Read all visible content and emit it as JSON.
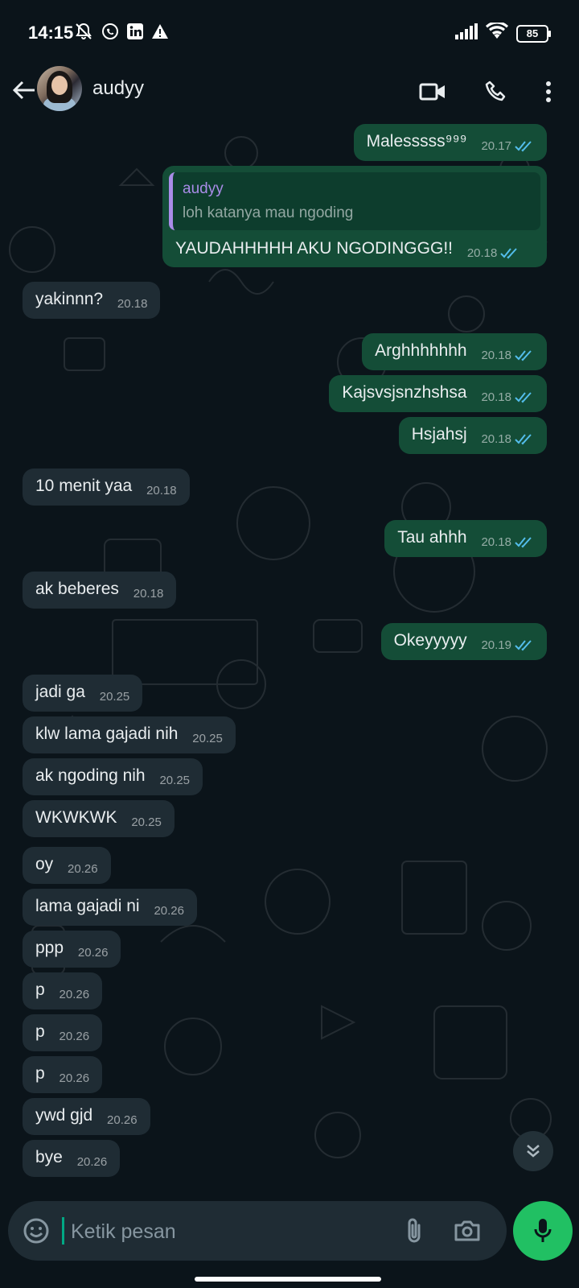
{
  "statusbar": {
    "time": "14:15",
    "battery": "85",
    "left_icons": [
      "mute-bell-icon",
      "whatsapp-icon",
      "linkedin-icon",
      "warning-icon"
    ],
    "right_icons": [
      "signal-icon",
      "wifi-icon",
      "battery-icon"
    ]
  },
  "header": {
    "contact_name": "audyy",
    "icons": [
      "back-arrow-icon",
      "video-call-icon",
      "voice-call-icon",
      "more-vert-icon"
    ]
  },
  "messages": [
    {
      "dir": "out",
      "text": "Malesssss⁹⁹⁹",
      "time": "20.17",
      "status": "read"
    },
    {
      "dir": "out",
      "text": "YAUDAHHHHH AKU NGODINGGG!!",
      "time": "20.18",
      "status": "read",
      "reply": {
        "name": "audyy",
        "text": "loh katanya mau ngoding"
      }
    },
    {
      "dir": "in",
      "text": "yakinnn?",
      "time": "20.18"
    },
    {
      "dir": "out",
      "text": "Arghhhhhhh",
      "time": "20.18",
      "status": "read"
    },
    {
      "dir": "out",
      "text": "Kajsvsjsnzhshsa",
      "time": "20.18",
      "status": "read"
    },
    {
      "dir": "out",
      "text": "Hsjahsj",
      "time": "20.18",
      "status": "read"
    },
    {
      "dir": "in",
      "text": "10 menit yaa",
      "time": "20.18"
    },
    {
      "dir": "out",
      "text": "Tau ahhh",
      "time": "20.18",
      "status": "read"
    },
    {
      "dir": "in",
      "text": "ak beberes",
      "time": "20.18"
    },
    {
      "dir": "out",
      "text": "Okeyyyyy",
      "time": "20.19",
      "status": "read"
    },
    {
      "dir": "in",
      "text": "jadi ga",
      "time": "20.25"
    },
    {
      "dir": "in",
      "text": "klw lama gajadi nih",
      "time": "20.25"
    },
    {
      "dir": "in",
      "text": "ak ngoding nih",
      "time": "20.25"
    },
    {
      "dir": "in",
      "text": "WKWKWK",
      "time": "20.25"
    },
    {
      "dir": "in",
      "text": "oy",
      "time": "20.26"
    },
    {
      "dir": "in",
      "text": "lama gajadi ni",
      "time": "20.26"
    },
    {
      "dir": "in",
      "text": "ppp",
      "time": "20.26"
    },
    {
      "dir": "in",
      "text": "p",
      "time": "20.26"
    },
    {
      "dir": "in",
      "text": "p",
      "time": "20.26"
    },
    {
      "dir": "in",
      "text": "p",
      "time": "20.26"
    },
    {
      "dir": "in",
      "text": "ywd gjd",
      "time": "20.26"
    },
    {
      "dir": "in",
      "text": "bye",
      "time": "20.26"
    }
  ],
  "composer": {
    "placeholder": "Ketik pesan",
    "icons": [
      "emoji-icon",
      "attach-icon",
      "camera-icon",
      "mic-icon"
    ]
  },
  "colors": {
    "background": "#0b141a",
    "outgoing_bubble": "#144d37",
    "incoming_bubble": "#1f2c34",
    "read_ticks": "#53bdeb",
    "mic_button": "#21c063",
    "reply_accent": "#a98ce8"
  }
}
